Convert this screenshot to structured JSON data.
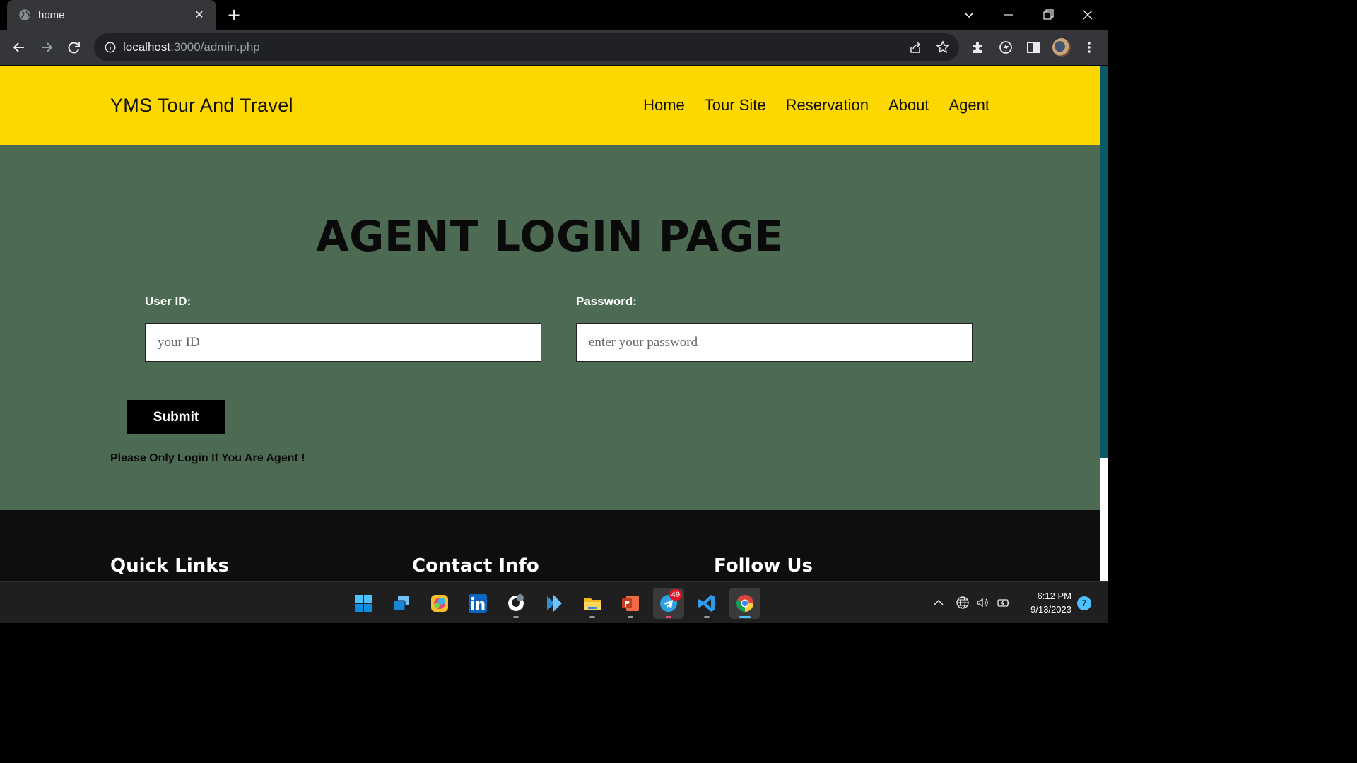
{
  "browser": {
    "tab_title": "home",
    "url_host": "localhost",
    "url_rest": ":3000/admin.php"
  },
  "site": {
    "brand": "YMS Tour And Travel",
    "nav": [
      "Home",
      "Tour Site",
      "Reservation",
      "About",
      "Agent"
    ],
    "accent_color": "#fdd700",
    "background_color": "#4d6a53"
  },
  "login": {
    "title": "AGENT LOGIN PAGE",
    "user_label": "User ID:",
    "user_placeholder": "your ID",
    "user_value": "",
    "password_label": "Password:",
    "password_placeholder": "enter your password",
    "password_value": "",
    "submit_label": "Submit",
    "notice": "Please Only Login If You Are Agent !"
  },
  "footer": {
    "headings": [
      "Quick Links",
      "Contact Info",
      "Follow Us"
    ]
  },
  "taskbar": {
    "apps": [
      "start-icon",
      "task-view-icon",
      "photos-icon",
      "linkedin-icon",
      "github-icon",
      "visual-studio-icon",
      "file-explorer-icon",
      "powerpoint-icon",
      "telegram-icon",
      "vscode-icon",
      "chrome-icon"
    ],
    "telegram_badge": "49",
    "time": "6:12 PM",
    "date": "9/13/2023",
    "notification_count": "7"
  }
}
